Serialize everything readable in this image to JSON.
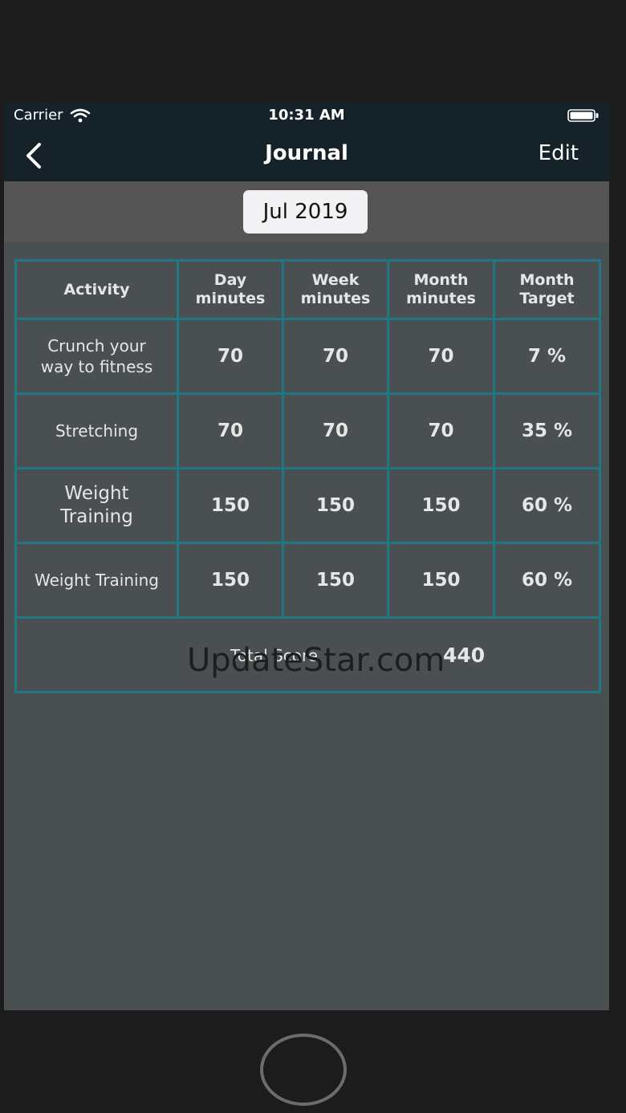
{
  "status_bar": {
    "carrier": "Carrier",
    "time": "10:31 AM",
    "wifi_icon": "wifi-icon",
    "battery_icon": "battery-icon"
  },
  "nav": {
    "back_icon": "chevron-left-icon",
    "title": "Journal",
    "edit_label": "Edit"
  },
  "month_selector": {
    "label": "Jul 2019"
  },
  "table": {
    "headers": {
      "activity": "Activity",
      "day_1": "Day",
      "day_2": "minutes",
      "week_1": "Week",
      "week_2": "minutes",
      "month_1": "Month",
      "month_2": "minutes",
      "target_1": "Month",
      "target_2": "Target"
    },
    "rows": [
      {
        "activity_line1": "Crunch your",
        "activity_line2": "way to fitness",
        "day": "70",
        "week": "70",
        "month": "70",
        "target": "7 %"
      },
      {
        "activity": "Stretching",
        "day": "70",
        "week": "70",
        "month": "70",
        "target": "35 %"
      },
      {
        "activity_line1": "Weight",
        "activity_line2": "Training",
        "day": "150",
        "week": "150",
        "month": "150",
        "target": "60 %"
      },
      {
        "activity": "Weight Training",
        "day": "150",
        "week": "150",
        "month": "150",
        "target": "60 %"
      }
    ],
    "total_label": "Total Score",
    "total_value": "440"
  },
  "watermark": "UpdateStar.com",
  "colors": {
    "bar_background": "#15222a",
    "content_background": "#4a4f52",
    "grid_border": "#207784",
    "month_button_bg": "#f2f2f4"
  }
}
